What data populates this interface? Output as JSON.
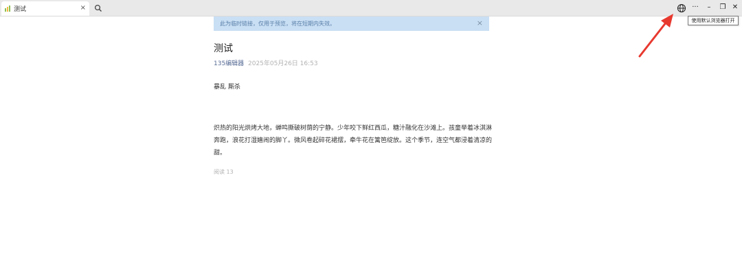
{
  "browser": {
    "tab_title": "测试",
    "tab_close": "×",
    "window_controls": {
      "more": "···",
      "minimize": "–",
      "restore": "❐",
      "close": "✕"
    },
    "tooltip": "使用默认浏览器打开"
  },
  "notice": {
    "text": "此为临时链接，仅用于预览，将在短期内失效。",
    "close": "×"
  },
  "article": {
    "title": "测试",
    "author": "135编辑器",
    "date": "2025年05月26日 16:53",
    "paragraph1": "暴乱 厮杀",
    "paragraph2": "炽热的阳光烘烤大地，蝉鸣撕破树荫的宁静。少年咬下鲜红西瓜，糖汁融化在沙滩上。孩童举着冰淇淋奔跑，浪花打湿嬉闹的脚丫。微风卷起碎花裙摆，牵牛花在篱笆绽放。这个季节，连空气都浸着清凉的甜。",
    "read_count": "阅读 13"
  },
  "colors": {
    "notice_bg": "#c9dff4",
    "author_link": "#576b95",
    "annotation_arrow": "#e8392f"
  },
  "icons": [
    "favicon-icon",
    "search-icon",
    "globe-icon"
  ]
}
